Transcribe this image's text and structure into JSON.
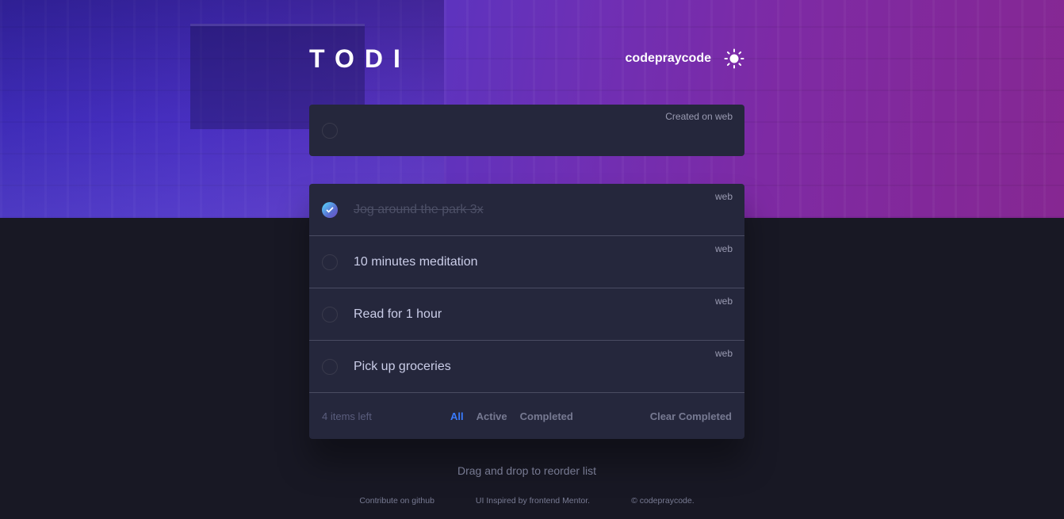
{
  "app": {
    "logo": "TODI",
    "username": "codepraycode",
    "theme_icon": "sun-icon"
  },
  "new_todo": {
    "placeholder": "",
    "value": "",
    "source": "Created on web"
  },
  "todos": [
    {
      "text": "Jog around the park 3x",
      "completed": true,
      "source": "web"
    },
    {
      "text": "10 minutes meditation",
      "completed": false,
      "source": "web"
    },
    {
      "text": "Read for 1 hour",
      "completed": false,
      "source": "web"
    },
    {
      "text": "Pick up groceries",
      "completed": false,
      "source": "web"
    }
  ],
  "footer": {
    "items_left": "4 items left",
    "filters": [
      {
        "label": "All",
        "active": true
      },
      {
        "label": "Active",
        "active": false
      },
      {
        "label": "Completed",
        "active": false
      }
    ],
    "clear_label": "Clear Completed"
  },
  "hint": "Drag and drop to reorder list",
  "credits": {
    "github": "Contribute on github",
    "inspired": "UI Inspired by frontend Mentor.",
    "copyright": "© codepraycode."
  },
  "colors": {
    "accent": "#3a7bfd",
    "background": "#181824",
    "card": "#25273c",
    "check_gradient_start": "#57ddff",
    "check_gradient_end": "#6b4fc9"
  }
}
